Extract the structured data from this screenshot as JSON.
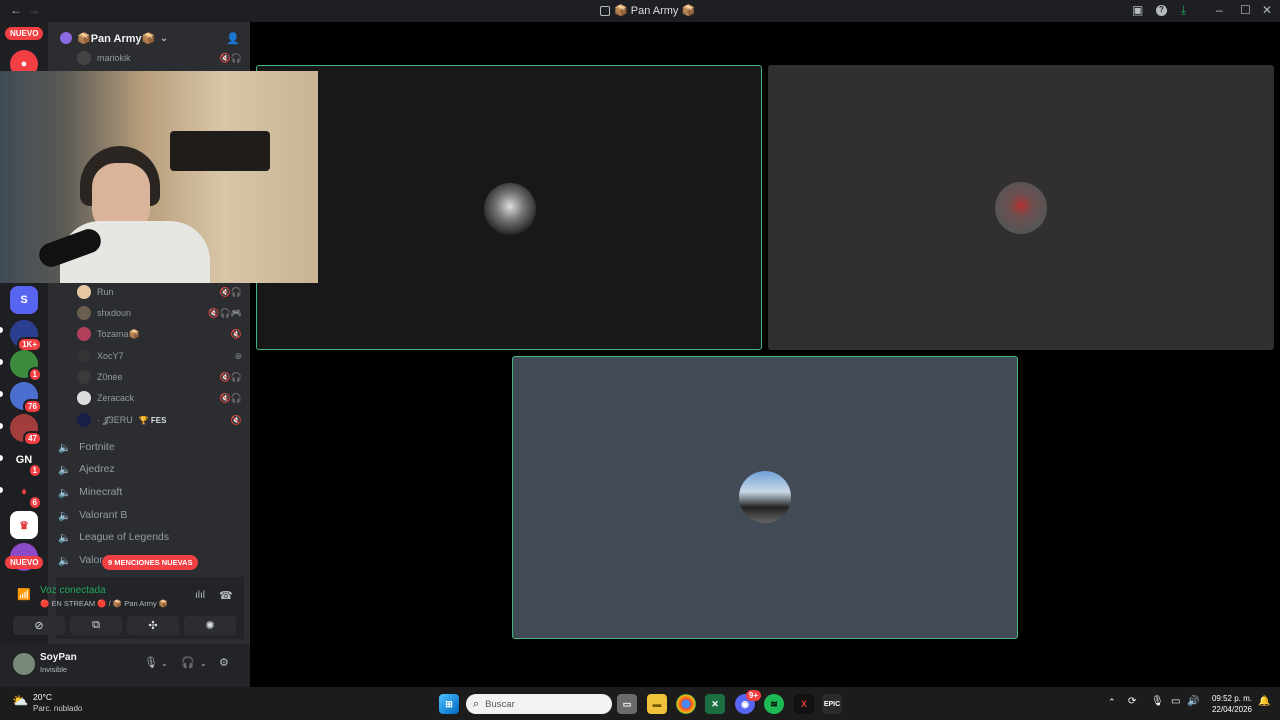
{
  "window": {
    "title": "📦 Pan Army 📦"
  },
  "server": {
    "name": "📦Pan Army📦"
  },
  "rail": {
    "nuevo_top": "NUEVO",
    "nuevo_bottom": "NUEVO",
    "badges": [
      "1K+",
      "1",
      "76",
      "47",
      "1",
      "6"
    ],
    "gn_label": "GN"
  },
  "members": [
    {
      "name": "mariokik",
      "icons": "🔇🎧"
    },
    {
      "name": "Run",
      "icons": "🔇🎧"
    },
    {
      "name": "shxdoun",
      "icons": "🔇🎧🎮"
    },
    {
      "name": "Tozama📦",
      "icons": "🔇"
    },
    {
      "name": "XocY7",
      "icons": "⊗"
    },
    {
      "name": "Z0nee",
      "icons": "🔇🎧"
    },
    {
      "name": "Zeracack",
      "icons": "🔇🎧"
    },
    {
      "name": "· 𝓙3ERU",
      "tag": "🏆 FES",
      "icons": "🔇"
    }
  ],
  "voice_channels": [
    "Fortnite",
    "Ajedrez",
    "Minecraft",
    "Valorant B",
    "League of Legends",
    "Valor"
  ],
  "mentions_pill": "9 MENCIONES NUEVAS",
  "voice": {
    "status": "Voz conectada",
    "sub": "🔴 EN STREAM 🔴 / 📦 Pan Army 📦"
  },
  "user": {
    "name": "SoyPan",
    "status": "Invisible"
  },
  "taskbar": {
    "temperature": "20°C",
    "condition": "Parc. nublado",
    "search_placeholder": "Buscar",
    "time": "09:52 p. m.",
    "date": "22/04/2026",
    "discord_badge": "9+"
  },
  "colors": {
    "speaking_border": "#43b581",
    "tile1_bg": "#181818",
    "tile2_bg": "#322f30",
    "tile3_bg": "#424a56"
  }
}
